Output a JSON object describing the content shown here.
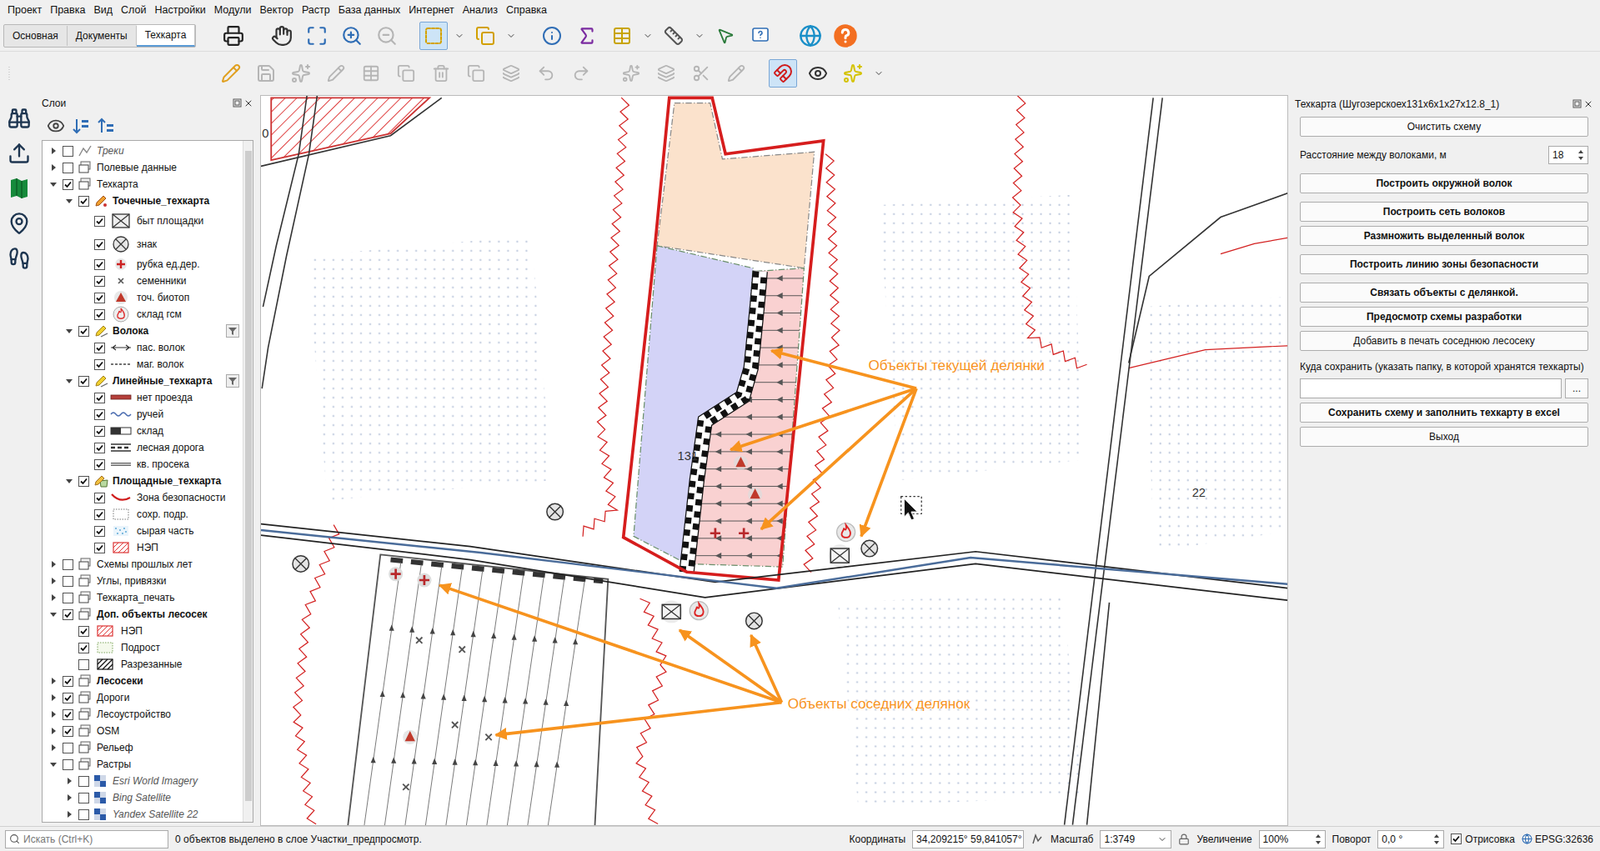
{
  "menu": [
    "Проект",
    "Правка",
    "Вид",
    "Слой",
    "Настройки",
    "Модули",
    "Вектор",
    "Растр",
    "База данных",
    "Интернет",
    "Анализ",
    "Справка"
  ],
  "toolbar_tabs": [
    {
      "label": "Основная",
      "selected": false
    },
    {
      "label": "Документы",
      "selected": false
    },
    {
      "label": "Техкарта",
      "selected": true
    }
  ],
  "toolbar_state": {
    "select_tool_active": true,
    "snapping_active": true
  },
  "layers_panel": {
    "title": "Слои",
    "items": [
      {
        "label": "Треки",
        "level": 0,
        "checked": false,
        "expanded": false,
        "kind": "track",
        "style": "italic"
      },
      {
        "label": "Полевые данные",
        "level": 0,
        "checked": false,
        "expanded": false,
        "kind": "group",
        "style": "normal"
      },
      {
        "label": "Техкарта",
        "level": 0,
        "checked": true,
        "expanded": true,
        "kind": "group",
        "style": "normal"
      },
      {
        "label": "Точечные_техкарта",
        "level": 1,
        "checked": true,
        "expanded": true,
        "kind": "point-layer",
        "style": "bold"
      },
      {
        "label": "быт площадки",
        "level": 2,
        "checked": true,
        "kind": "box-x",
        "style": "normal"
      },
      {
        "label": "знак",
        "level": 2,
        "checked": true,
        "kind": "circle-x",
        "style": "normal"
      },
      {
        "label": "рубка ед.дер.",
        "level": 2,
        "checked": true,
        "kind": "plus",
        "style": "normal"
      },
      {
        "label": "семенники",
        "level": 2,
        "checked": true,
        "kind": "cross",
        "style": "normal"
      },
      {
        "label": "точ. биотоп",
        "level": 2,
        "checked": true,
        "kind": "triangle",
        "style": "normal"
      },
      {
        "label": "склад гсм",
        "level": 2,
        "checked": true,
        "kind": "fire",
        "style": "normal"
      },
      {
        "label": "Волока",
        "level": 1,
        "checked": true,
        "expanded": true,
        "kind": "line-layer",
        "style": "bold",
        "filter": true
      },
      {
        "label": "пас. волок",
        "level": 2,
        "checked": true,
        "kind": "arrow-line",
        "style": "normal"
      },
      {
        "label": "маг. волок",
        "level": 2,
        "checked": true,
        "kind": "dash-line",
        "style": "normal"
      },
      {
        "label": "Линейные_техкарта",
        "level": 1,
        "checked": true,
        "expanded": true,
        "kind": "line-layer",
        "style": "bold",
        "filter": true
      },
      {
        "label": "нет проезда",
        "level": 2,
        "checked": true,
        "kind": "red-bar",
        "style": "normal"
      },
      {
        "label": "ручей",
        "level": 2,
        "checked": true,
        "kind": "wave",
        "style": "normal"
      },
      {
        "label": "склад",
        "level": 2,
        "checked": true,
        "kind": "gray-bar",
        "style": "normal"
      },
      {
        "label": "лесная дорога",
        "level": 2,
        "checked": true,
        "kind": "road",
        "style": "normal"
      },
      {
        "label": "кв. просека",
        "level": 2,
        "checked": true,
        "kind": "prospect",
        "style": "normal"
      },
      {
        "label": "Площадные_техкарта",
        "level": 1,
        "checked": true,
        "expanded": true,
        "kind": "poly-layer",
        "style": "bold"
      },
      {
        "label": "Зона безопасности",
        "level": 2,
        "checked": true,
        "kind": "red-line",
        "style": "normal"
      },
      {
        "label": "сохр. подр.",
        "level": 2,
        "checked": true,
        "kind": "dotted-box",
        "style": "normal"
      },
      {
        "label": "сырая часть",
        "level": 2,
        "checked": true,
        "kind": "blue-dots",
        "style": "normal"
      },
      {
        "label": "НЭП",
        "level": 2,
        "checked": true,
        "kind": "red-hatch",
        "style": "normal"
      },
      {
        "label": "Схемы прошлых лет",
        "level": 0,
        "checked": false,
        "expanded": false,
        "kind": "group",
        "style": "normal"
      },
      {
        "label": "Углы, привязки",
        "level": 0,
        "checked": false,
        "expanded": false,
        "kind": "group",
        "style": "normal"
      },
      {
        "label": "Техкарта_печать",
        "level": 0,
        "checked": false,
        "expanded": false,
        "kind": "group",
        "style": "normal"
      },
      {
        "label": "Доп. объекты лесосек",
        "level": 0,
        "checked": true,
        "expanded": true,
        "kind": "group",
        "style": "bold"
      },
      {
        "label": "НЭП",
        "level": 1,
        "checked": true,
        "kind": "red-hatch",
        "style": "normal"
      },
      {
        "label": "Подрост",
        "level": 1,
        "checked": true,
        "kind": "green-dots",
        "style": "normal"
      },
      {
        "label": "Разрезанные",
        "level": 1,
        "checked": false,
        "kind": "black-hatch",
        "style": "normal"
      },
      {
        "label": "Лесосеки",
        "level": 0,
        "checked": true,
        "expanded": false,
        "kind": "group",
        "style": "bold"
      },
      {
        "label": "Дороги",
        "level": 0,
        "checked": true,
        "expanded": false,
        "kind": "group",
        "style": "normal"
      },
      {
        "label": "Лесоустройство",
        "level": 0,
        "checked": true,
        "expanded": false,
        "kind": "group",
        "style": "normal"
      },
      {
        "label": "OSM",
        "level": 0,
        "checked": true,
        "expanded": false,
        "kind": "group",
        "style": "normal"
      },
      {
        "label": "Рельеф",
        "level": 0,
        "checked": false,
        "expanded": false,
        "kind": "group",
        "style": "normal"
      },
      {
        "label": "Растры",
        "level": 0,
        "checked": false,
        "expanded": true,
        "kind": "group",
        "style": "normal"
      },
      {
        "label": "Esri World Imagery",
        "level": 1,
        "checked": false,
        "expanded": false,
        "kind": "raster",
        "style": "italic"
      },
      {
        "label": "Bing Satellite",
        "level": 1,
        "checked": false,
        "expanded": false,
        "kind": "raster",
        "style": "italic"
      },
      {
        "label": "Yandex Satellite 22",
        "level": 1,
        "checked": false,
        "expanded": false,
        "kind": "raster",
        "style": "italic"
      }
    ]
  },
  "map": {
    "labels": [
      "131",
      "22",
      "0"
    ],
    "annotations": [
      "Объекты текущей делянки",
      "Объекты соседних делянок"
    ]
  },
  "dock": {
    "title": "Техкарта (Шугозерскоех131х6х1х27х12.8_1)",
    "sections": [
      [
        {
          "kind": "button",
          "label": "Очистить схему",
          "bold": false
        }
      ],
      [
        {
          "kind": "spin",
          "label": "Расстояние между волоками, м",
          "value": "18"
        }
      ],
      [
        {
          "kind": "button",
          "label": "Построить окружной волок",
          "bold": true
        }
      ],
      [
        {
          "kind": "button",
          "label": "Построить сеть волоков",
          "bold": true
        },
        {
          "kind": "button",
          "label": "Размножить выделенный волок",
          "bold": true
        }
      ],
      [
        {
          "kind": "button",
          "label": "Построить линию зоны безопасности",
          "bold": true
        }
      ],
      [
        {
          "kind": "button",
          "label": "Связать объекты с делянкой.",
          "bold": true
        },
        {
          "kind": "button",
          "label": "Предосмотр схемы разработки",
          "bold": true
        },
        {
          "kind": "button",
          "label": "Добавить в печать соседнюю лесосеку",
          "bold": false
        }
      ],
      [
        {
          "kind": "label",
          "label": "Куда сохранить (указать папку, в которой хранятся техкарты)"
        },
        {
          "kind": "path",
          "value": "",
          "button": "..."
        },
        {
          "kind": "button",
          "label": "Сохранить схему и заполнить техкарту в excel",
          "bold": true
        },
        {
          "kind": "button",
          "label": "Выход",
          "bold": false
        }
      ]
    ]
  },
  "status_bar": {
    "search_placeholder": "Искать (Ctrl+K)",
    "message": "0 объектов выделено в слое Участки_предпросмотр.",
    "coordinates_label": "Координаты",
    "coordinates": "34,209215° 59,841057°",
    "scale_label": "Масштаб",
    "scale": "1:3749",
    "magnifier_label": "Увеличение",
    "magnifier": "100%",
    "rotation_label": "Поворот",
    "rotation": "0,0 °",
    "render": {
      "label": "Отрисовка",
      "checked": true
    },
    "crs": "EPSG:32636"
  }
}
